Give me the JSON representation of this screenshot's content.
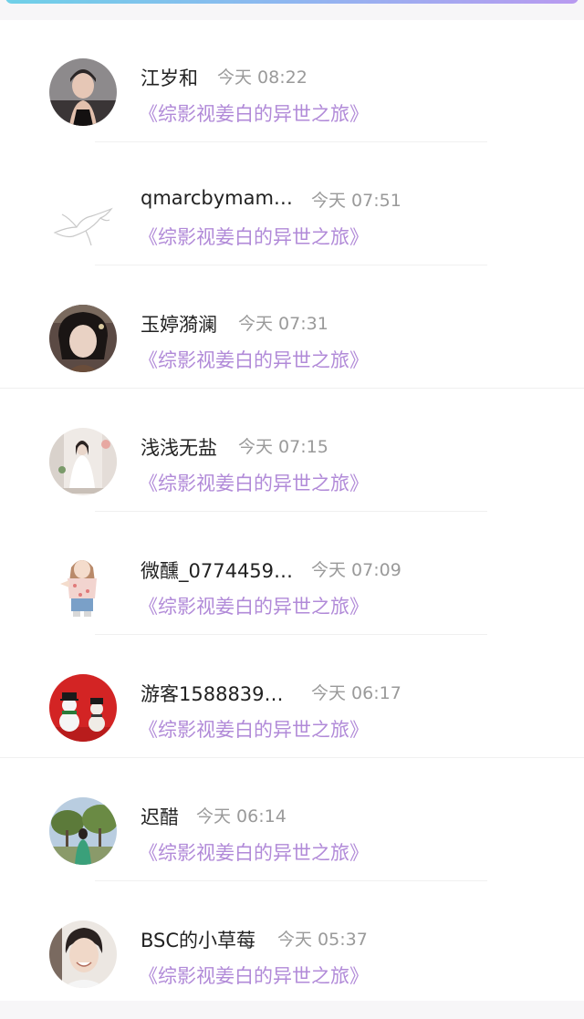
{
  "accent_colors": {
    "book_title": "#b18ad8",
    "time": "#9a9a9a",
    "name": "#222222"
  },
  "items": [
    {
      "name": "江岁和",
      "time": "今天 08:22",
      "book": "《综影视姜白的异世之旅》",
      "avatar": "portrait-avatar-icon"
    },
    {
      "name": "qmarcbymam…",
      "time": "今天 07:51",
      "book": "《综影视姜白的异世之旅》",
      "avatar": "bird-sketch-avatar-icon"
    },
    {
      "name": "玉婷漪澜",
      "time": "今天 07:31",
      "book": "《综影视姜白的异世之旅》",
      "avatar": "portrait-avatar-icon"
    },
    {
      "name": "浅浅无盐",
      "time": "今天 07:15",
      "book": "《综影视姜白的异世之旅》",
      "avatar": "portrait-avatar-icon"
    },
    {
      "name": "微醺_0774459…",
      "time": "今天 07:09",
      "book": "《综影视姜白的异世之旅》",
      "avatar": "cartoon-girl-avatar-icon"
    },
    {
      "name": "游客1588839…",
      "time": "今天 06:17",
      "book": "《综影视姜白的异世之旅》",
      "avatar": "snowman-avatar-icon"
    },
    {
      "name": "迟醋",
      "time": "今天 06:14",
      "book": "《综影视姜白的异世之旅》",
      "avatar": "landscape-avatar-icon"
    },
    {
      "name": "BSC的小草莓",
      "time": "今天 05:37",
      "book": "《综影视姜白的异世之旅》",
      "avatar": "portrait-avatar-icon"
    }
  ]
}
